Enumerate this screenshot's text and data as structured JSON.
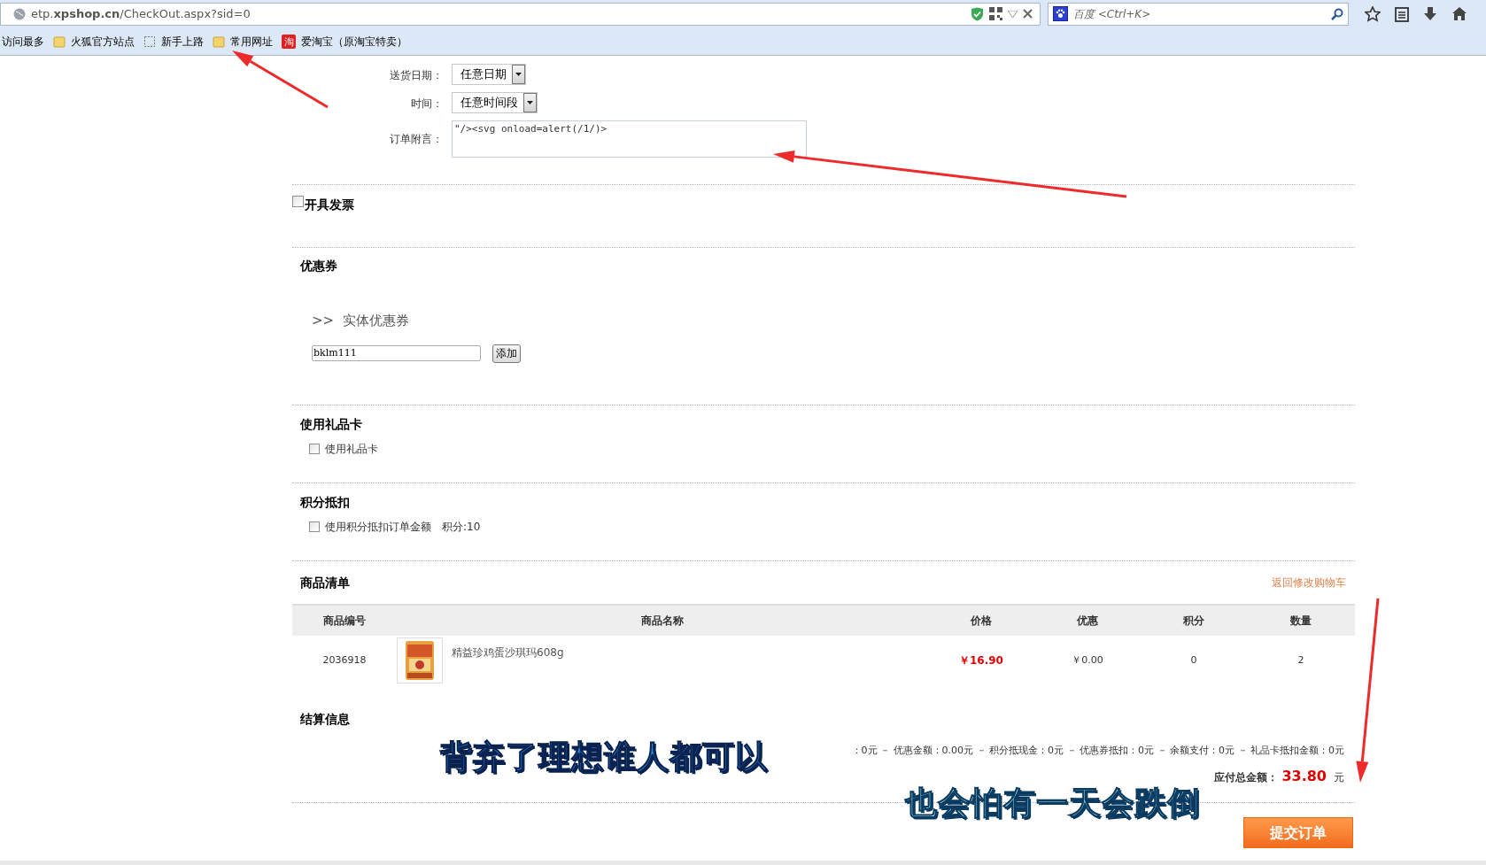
{
  "browser": {
    "url": "etp.**xpshop.cn**/CheckOut.aspx?sid=0",
    "search_placeholder": "百度 <Ctrl+K>",
    "bookmarks": [
      {
        "label": "访问最多",
        "kind": "plain"
      },
      {
        "label": "火狐官方站点",
        "kind": "folder"
      },
      {
        "label": "新手上路",
        "kind": "page"
      },
      {
        "label": "常用网址",
        "kind": "folder"
      },
      {
        "label": "爱淘宝（原淘宝特卖）",
        "kind": "badge",
        "badge": "淘"
      }
    ]
  },
  "delivery": {
    "fields": [
      {
        "label": "送货日期：",
        "kind": "select",
        "value": "任意日期"
      },
      {
        "label": "时间：",
        "kind": "select",
        "value": "任意时间段"
      },
      {
        "label": "订单附言：",
        "kind": "textarea",
        "value": "\"/><svg onload=alert(/1/)>"
      }
    ]
  },
  "invoice": {
    "label": "开具发票",
    "checked": false
  },
  "coupon": {
    "title": "优惠券",
    "subtitle_marker": ">>",
    "subtitle": "实体优惠券",
    "code": "bklm111",
    "add_button": "添加"
  },
  "gift_card": {
    "title": "使用礼品卡",
    "option": {
      "label": "使用礼品卡",
      "checked": false
    }
  },
  "points": {
    "title": "积分抵扣",
    "option": {
      "label": "使用积分抵扣订单金额",
      "checked": false
    },
    "balance": "积分:10"
  },
  "products": {
    "title": "商品清单",
    "back_link": "返回修改购物车",
    "columns": [
      "商品编号",
      "商品名称",
      "价格",
      "优惠",
      "积分",
      "数量"
    ],
    "rows": [
      {
        "code": "2036918",
        "name": "精益珍鸡蛋沙琪玛608g",
        "price": "￥16.90",
        "discount": "￥0.00",
        "points": "0",
        "quantity": "2"
      }
    ]
  },
  "settlement": {
    "title": "结算信息",
    "breakdown": "：0元 － 优惠金额：0.00元 － 积分抵现金：0元 － 优惠券抵扣：0元 － 余额支付：0元 － 礼品卡抵扣金额：0元",
    "total_label": "应付总金额：",
    "total": "33.80",
    "currency": "元",
    "submit": "提交订单"
  },
  "captions": [
    "背弃了理想谁人都可以",
    "也会怕有一天会跌倒"
  ]
}
